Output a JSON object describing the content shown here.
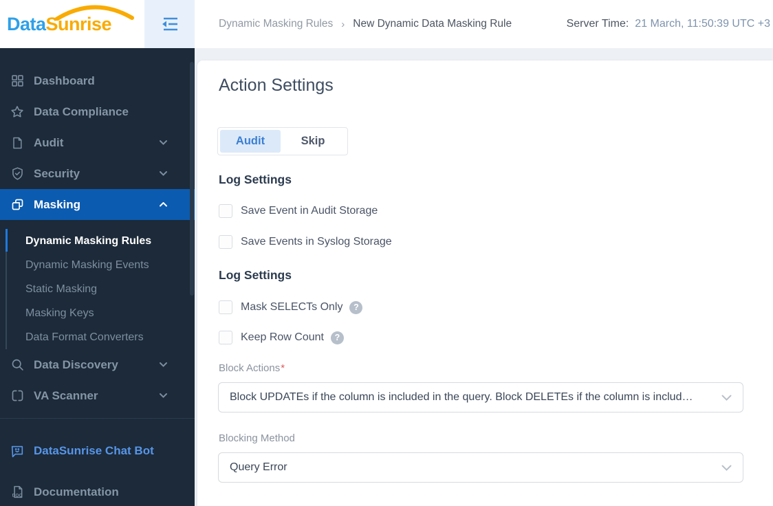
{
  "logo": {
    "part1": "Data",
    "part2": "Sunrise"
  },
  "header": {
    "breadcrumb_prev": "Dynamic Masking Rules",
    "breadcrumb_sep": "›",
    "breadcrumb_current": "New Dynamic Data Masking Rule",
    "server_time_label": "Server Time:",
    "server_time_value": "21 March, 11:50:39 UTC +3"
  },
  "sidebar": {
    "items": [
      {
        "label": "Dashboard",
        "icon": "dashboard-grid-icon"
      },
      {
        "label": "Data Compliance",
        "icon": "star-icon"
      },
      {
        "label": "Audit",
        "icon": "document-icon",
        "chevron": "down"
      },
      {
        "label": "Security",
        "icon": "shield-check-icon",
        "chevron": "down"
      },
      {
        "label": "Masking",
        "icon": "masking-icon",
        "chevron": "up",
        "active": true
      }
    ],
    "masking_subitems": [
      {
        "label": "Dynamic Masking Rules",
        "active": true
      },
      {
        "label": "Dynamic Masking Events",
        "active": false
      },
      {
        "label": "Static Masking",
        "active": false
      },
      {
        "label": "Masking Keys",
        "active": false
      },
      {
        "label": "Data Format Converters",
        "active": false
      }
    ],
    "items_after": [
      {
        "label": "Data Discovery",
        "icon": "search-icon",
        "chevron": "down"
      },
      {
        "label": "VA Scanner",
        "icon": "scanner-icon",
        "chevron": "down"
      }
    ],
    "footer_items": [
      {
        "label": "DataSunrise Chat Bot",
        "icon": "chat-bot-icon",
        "highlighted": true
      },
      {
        "label": "Documentation",
        "icon": "doc-file-icon",
        "highlighted": false
      }
    ]
  },
  "main": {
    "title": "Action Settings",
    "toggle": {
      "selected": "Audit",
      "unselected": "Skip"
    },
    "log_settings_1": {
      "heading": "Log Settings",
      "checkboxes": [
        {
          "label": "Save Event in Audit Storage",
          "checked": false
        },
        {
          "label": "Save Events in Syslog Storage",
          "checked": false
        }
      ]
    },
    "log_settings_2": {
      "heading": "Log Settings",
      "checkboxes": [
        {
          "label": "Mask SELECTs Only",
          "checked": false,
          "help": "?"
        },
        {
          "label": "Keep Row Count",
          "checked": false,
          "help": "?"
        }
      ]
    },
    "block_actions": {
      "label": "Block Actions",
      "required_mark": "*",
      "value": "Block UPDATEs if the column is included in the query. Block DELETEs if the column is includ…"
    },
    "blocking_method": {
      "label": "Blocking Method",
      "value": "Query Error"
    }
  },
  "colors": {
    "sidebar_bg": "#1c2a39",
    "active_item_bg": "#0b5bb0",
    "accent_blue": "#3b7fd3",
    "logo_blue": "#2ea0e8",
    "logo_orange": "#f9ab00",
    "content_bg": "#edf1f5",
    "required_red": "#e05c5c"
  }
}
